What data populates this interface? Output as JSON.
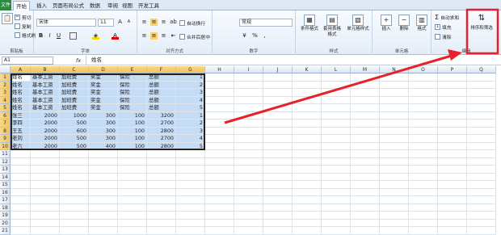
{
  "tabs": [
    "开始",
    "插入",
    "页面布局",
    "公式",
    "数据",
    "审阅",
    "视图",
    "开发工具"
  ],
  "file_tab": "文件",
  "ribbon": {
    "clipboard": {
      "cut": "剪切",
      "copy": "复制",
      "painter": "格式刷",
      "label": "剪贴板"
    },
    "font": {
      "name": "宋体",
      "size": "11",
      "label": "字体"
    },
    "align": {
      "wrap": "自动换行",
      "merge": "合并后居中",
      "label": "对齐方式"
    },
    "number": {
      "format": "常规",
      "label": "数字"
    },
    "styles": {
      "cond": "条件格式",
      "table": "套用表格格式",
      "cell": "单元格样式",
      "label": "样式"
    },
    "cells": {
      "insert": "插入",
      "delete": "删除",
      "format": "格式",
      "label": "单元格"
    },
    "editing": {
      "autosum": "自动求和",
      "fill": "填充",
      "clear": "清除",
      "sort": "排序和筛选",
      "label": "编辑"
    }
  },
  "formula_bar": {
    "name_box": "A1",
    "fx": "fx",
    "content": "姓名"
  },
  "columns": [
    "A",
    "B",
    "C",
    "D",
    "E",
    "F",
    "G",
    "H",
    "I",
    "J",
    "K",
    "L",
    "M",
    "N",
    "O",
    "P",
    "Q"
  ],
  "rows": [
    [
      "姓名",
      "基本工资",
      "加班费",
      "奖金",
      "保险",
      "总额",
      "1"
    ],
    [
      "姓名",
      "基本工资",
      "加班费",
      "奖金",
      "保险",
      "总额",
      "2"
    ],
    [
      "姓名",
      "基本工资",
      "加班费",
      "奖金",
      "保险",
      "总额",
      "3"
    ],
    [
      "姓名",
      "基本工资",
      "加班费",
      "奖金",
      "保险",
      "总额",
      "4"
    ],
    [
      "姓名",
      "基本工资",
      "加班费",
      "奖金",
      "保险",
      "总额",
      "5"
    ],
    [
      "张三",
      "2000",
      "1000",
      "300",
      "100",
      "3200",
      "1"
    ],
    [
      "李四",
      "2000",
      "500",
      "300",
      "100",
      "2700",
      "2"
    ],
    [
      "王五",
      "2000",
      "600",
      "300",
      "100",
      "2800",
      "3"
    ],
    [
      "老刘",
      "2000",
      "500",
      "300",
      "100",
      "2700",
      "4"
    ],
    [
      "老六",
      "2000",
      "500",
      "400",
      "100",
      "2800",
      "5"
    ]
  ],
  "row_numbers": [
    "1",
    "2",
    "3",
    "4",
    "5",
    "6",
    "7",
    "8",
    "9",
    "10",
    "11",
    "12",
    "13",
    "14",
    "15",
    "16",
    "17",
    "18",
    "19",
    "20",
    "21"
  ],
  "colors": {
    "arrow": "#e8202a",
    "selection": "#c6dcf5",
    "excel_green": "#2a8a3e"
  }
}
